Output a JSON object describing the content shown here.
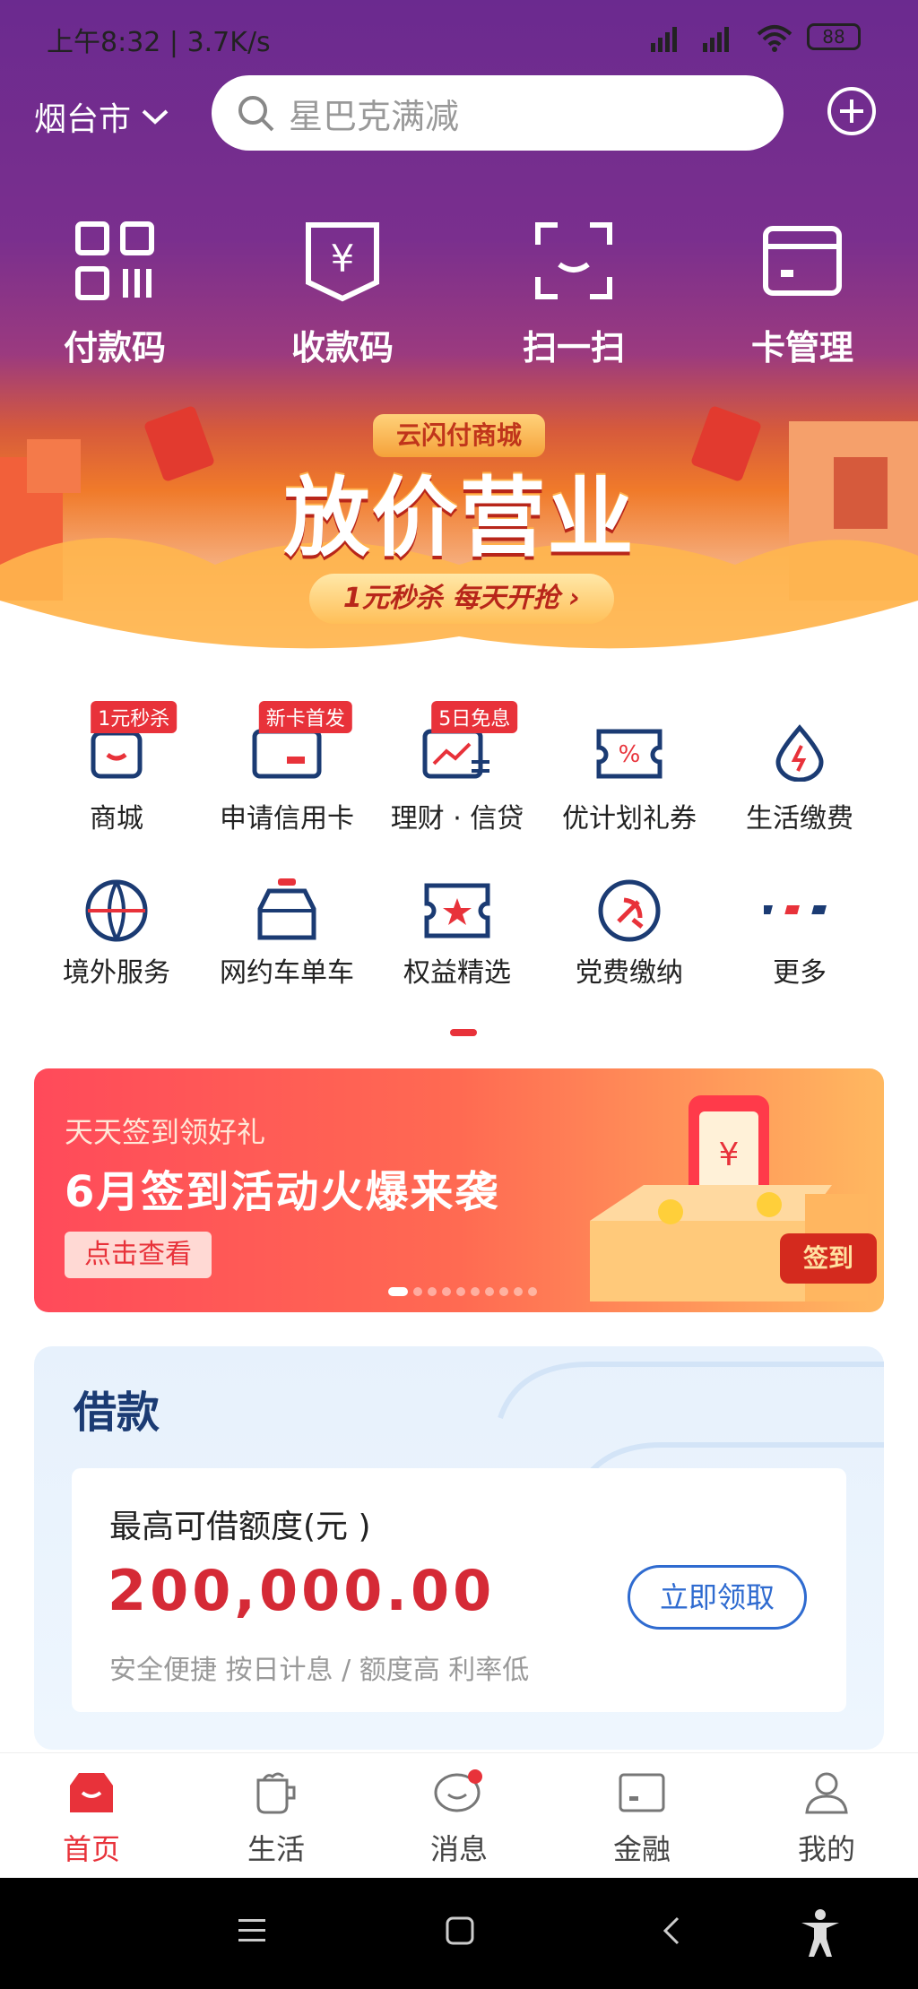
{
  "status_bar": {
    "time": "上午8:32",
    "speed": "3.7K/s",
    "battery": "88"
  },
  "header": {
    "city": "烟台市",
    "search_placeholder": "星巴克满减",
    "quick_actions": [
      {
        "label": "付款码",
        "icon": "qr-code-icon"
      },
      {
        "label": "收款码",
        "icon": "yen-pocket-icon"
      },
      {
        "label": "扫一扫",
        "icon": "scan-icon"
      },
      {
        "label": "卡管理",
        "icon": "card-icon"
      }
    ]
  },
  "banner": {
    "badge": "云闪付商城",
    "title": "放价营业",
    "subtitle": "1元秒杀 每天开抢"
  },
  "services": [
    {
      "label": "商城",
      "tag": "1元秒杀",
      "icon": "mall-icon"
    },
    {
      "label": "申请信用卡",
      "tag": "新卡首发",
      "icon": "credit-card-icon"
    },
    {
      "label": "理财 · 信贷",
      "tag": "5日免息",
      "icon": "finance-icon"
    },
    {
      "label": "优计划礼券",
      "tag": "",
      "icon": "coupon-icon"
    },
    {
      "label": "生活缴费",
      "tag": "",
      "icon": "utility-icon"
    },
    {
      "label": "境外服务",
      "tag": "",
      "icon": "globe-icon"
    },
    {
      "label": "网约车单车",
      "tag": "",
      "icon": "car-icon"
    },
    {
      "label": "权益精选",
      "tag": "",
      "icon": "star-ticket-icon"
    },
    {
      "label": "党费缴纳",
      "tag": "",
      "icon": "party-icon"
    },
    {
      "label": "更多",
      "tag": "",
      "icon": "more-icon"
    }
  ],
  "promo": {
    "line1": "天天签到领好礼",
    "line2": "6月签到活动火爆来袭",
    "button": "点击查看",
    "sign": "签到"
  },
  "loan": {
    "title": "借款",
    "label": "最高可借额度(元 )",
    "amount": "200,000.00",
    "desc": "安全便捷 按日计息  /  额度高 利率低",
    "button": "立即领取"
  },
  "tabbar": [
    {
      "label": "首页",
      "active": true
    },
    {
      "label": "生活",
      "active": false
    },
    {
      "label": "消息",
      "active": false
    },
    {
      "label": "金融",
      "active": false
    },
    {
      "label": "我的",
      "active": false
    }
  ],
  "colors": {
    "accent": "#e8323a",
    "purple": "#6b2a8f",
    "loan_blue": "#1b3b73"
  }
}
